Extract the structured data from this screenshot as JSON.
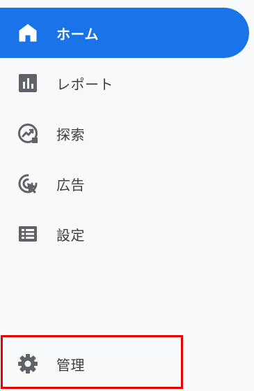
{
  "sidebar": {
    "items": [
      {
        "key": "home",
        "label": "ホーム",
        "icon": "home-icon",
        "active": true
      },
      {
        "key": "reports",
        "label": "レポート",
        "icon": "bar-chart-icon",
        "active": false
      },
      {
        "key": "explore",
        "label": "探索",
        "icon": "explore-chart-icon",
        "active": false
      },
      {
        "key": "advertising",
        "label": "広告",
        "icon": "cursor-target-icon",
        "active": false
      },
      {
        "key": "configure",
        "label": "設定",
        "icon": "list-icon",
        "active": false
      }
    ],
    "admin": {
      "label": "管理",
      "icon": "gear-icon"
    }
  },
  "colors": {
    "accent": "#1a73e8",
    "background": "#f8f9fb",
    "text": "#3c4043",
    "icon": "#5f6368",
    "highlight": "#e60000"
  }
}
